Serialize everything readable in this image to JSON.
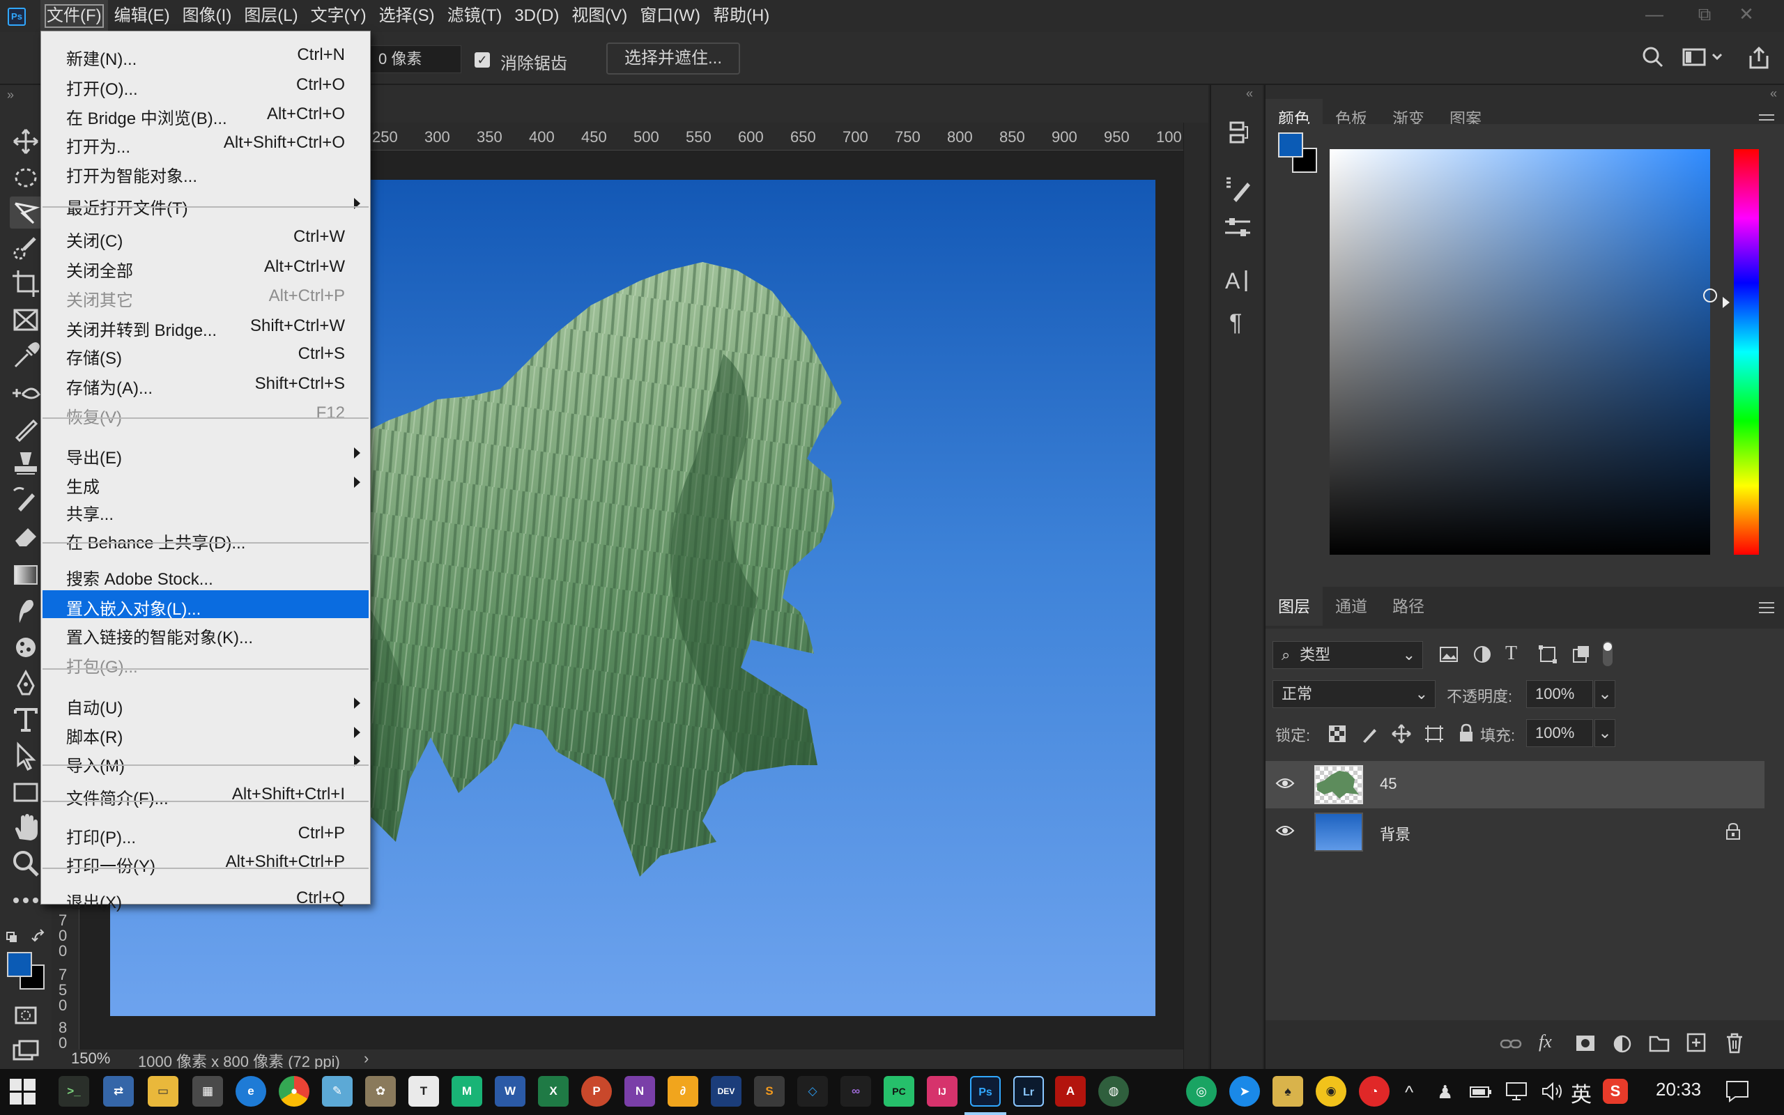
{
  "app": {
    "logo_text": "Ps"
  },
  "menubar": {
    "items": [
      "文件(F)",
      "编辑(E)",
      "图像(I)",
      "图层(L)",
      "文字(Y)",
      "选择(S)",
      "滤镜(T)",
      "3D(D)",
      "视图(V)",
      "窗口(W)",
      "帮助(H)"
    ],
    "active_index": 0
  },
  "window_controls": {
    "minimize": "—",
    "restore": "⧉",
    "close": "✕"
  },
  "options_bar": {
    "feather_value": "0 像素",
    "antialias_checked": true,
    "antialias_label": "消除锯齿",
    "select_mask_button": "选择并遮住..."
  },
  "file_menu": {
    "items": [
      {
        "label": "新建(N)...",
        "shortcut": "Ctrl+N"
      },
      {
        "label": "打开(O)...",
        "shortcut": "Ctrl+O"
      },
      {
        "label": "在 Bridge 中浏览(B)...",
        "shortcut": "Alt+Ctrl+O"
      },
      {
        "label": "打开为...",
        "shortcut": "Alt+Shift+Ctrl+O"
      },
      {
        "label": "打开为智能对象...",
        "shortcut": ""
      },
      {
        "label": "最近打开文件(T)",
        "shortcut": "",
        "submenu": true
      },
      {
        "label": "关闭(C)",
        "shortcut": "Ctrl+W"
      },
      {
        "label": "关闭全部",
        "shortcut": "Alt+Ctrl+W"
      },
      {
        "label": "关闭其它",
        "shortcut": "Alt+Ctrl+P",
        "disabled": true
      },
      {
        "label": "关闭并转到 Bridge...",
        "shortcut": "Shift+Ctrl+W"
      },
      {
        "label": "存储(S)",
        "shortcut": "Ctrl+S"
      },
      {
        "label": "存储为(A)...",
        "shortcut": "Shift+Ctrl+S"
      },
      {
        "label": "恢复(V)",
        "shortcut": "F12",
        "disabled": true
      },
      {
        "label": "导出(E)",
        "shortcut": "",
        "submenu": true
      },
      {
        "label": "生成",
        "shortcut": "",
        "submenu": true
      },
      {
        "label": "共享...",
        "shortcut": ""
      },
      {
        "label": "在 Behance 上共享(D)...",
        "shortcut": ""
      },
      {
        "label": "搜索 Adobe Stock...",
        "shortcut": ""
      },
      {
        "label": "置入嵌入对象(L)...",
        "shortcut": "",
        "highlighted": true
      },
      {
        "label": "置入链接的智能对象(K)...",
        "shortcut": ""
      },
      {
        "label": "打包(G)...",
        "shortcut": "",
        "disabled": true
      },
      {
        "label": "自动(U)",
        "shortcut": "",
        "submenu": true
      },
      {
        "label": "脚本(R)",
        "shortcut": "",
        "submenu": true
      },
      {
        "label": "导入(M)",
        "shortcut": "",
        "submenu": true
      },
      {
        "label": "文件简介(F)...",
        "shortcut": "Alt+Shift+Ctrl+I"
      },
      {
        "label": "打印(P)...",
        "shortcut": "Ctrl+P"
      },
      {
        "label": "打印一份(Y)",
        "shortcut": "Alt+Shift+Ctrl+P"
      },
      {
        "label": "退出(X)",
        "shortcut": "Ctrl+Q"
      }
    ]
  },
  "ruler": {
    "top_labels": [
      "250",
      "300",
      "350",
      "400",
      "450",
      "500",
      "550",
      "600",
      "650",
      "700",
      "750",
      "800",
      "850",
      "900",
      "950",
      "100"
    ],
    "left_labels": [
      "7",
      "0",
      "0",
      "7",
      "5",
      "0",
      "8",
      "0"
    ]
  },
  "status_bar": {
    "zoom": "150%",
    "doc_info": "1000 像素 x 800 像素 (72 ppi)",
    "arrow": "›"
  },
  "colors": {
    "foreground": "#0b5bb5",
    "background": "#000000",
    "menu_highlight": "#0a6ce0",
    "canvas_sky_top": "#1358b5",
    "canvas_sky_bottom": "#6da3ee"
  },
  "color_panel": {
    "tabs": [
      "颜色",
      "色板",
      "渐变",
      "图案"
    ],
    "active_tab": 0
  },
  "layers_panel": {
    "tabs": [
      "图层",
      "通道",
      "路径"
    ],
    "active_tab": 0,
    "filter_type": "类型",
    "blend_mode": "正常",
    "opacity_label": "不透明度:",
    "opacity_value": "100%",
    "lock_label": "锁定:",
    "fill_label": "填充:",
    "fill_value": "100%",
    "layers": [
      {
        "name": "45",
        "visible": true,
        "selected": true,
        "locked": false,
        "thumb": "mountain"
      },
      {
        "name": "背景",
        "visible": true,
        "selected": false,
        "locked": true,
        "thumb": "blue-gradient"
      }
    ],
    "footer_icons": [
      "link-icon",
      "fx-icon",
      "mask-icon",
      "adjustment-icon",
      "folder-icon",
      "new-layer-icon",
      "trash-icon"
    ]
  },
  "panel_strip_icons": [
    "history-icon",
    "brush-settings-icon",
    "properties-icon",
    "character-icon",
    "paragraph-icon"
  ],
  "tools": [
    "move-tool-icon",
    "marquee-tool-icon",
    "lasso-tool-icon",
    "quick-select-tool-icon",
    "crop-tool-icon",
    "frame-tool-icon",
    "eyedropper-tool-icon",
    "healing-tool-icon",
    "brush-tool-icon",
    "stamp-tool-icon",
    "history-brush-icon",
    "eraser-tool-icon",
    "gradient-tool-icon",
    "smudge-tool-icon",
    "sponge-tool-icon",
    "pen-tool-icon",
    "type-tool-icon",
    "path-select-tool-icon",
    "rectangle-tool-icon",
    "hand-tool-icon",
    "zoom-tool-icon",
    "more-tools-icon"
  ],
  "taskbar": {
    "apps": [
      "windows-start-icon",
      "terminal-app",
      "network-app",
      "file-explorer-app",
      "calculator-app",
      "edge-app",
      "chrome-app",
      "notepad-app",
      "paint-app",
      "typora-app",
      "mindmaster-app",
      "word-app",
      "excel-app",
      "powerpoint-app",
      "onenote-app",
      "evernote-app",
      "devtools-app",
      "sublime-app",
      "vscode-app",
      "visualstudio-app",
      "pycharm-app",
      "intellij-app",
      "photoshop-app",
      "lightroom-app",
      "acrobat-app",
      "chromium-app"
    ],
    "tray": {
      "ime": "英",
      "clock": "20:33"
    }
  }
}
